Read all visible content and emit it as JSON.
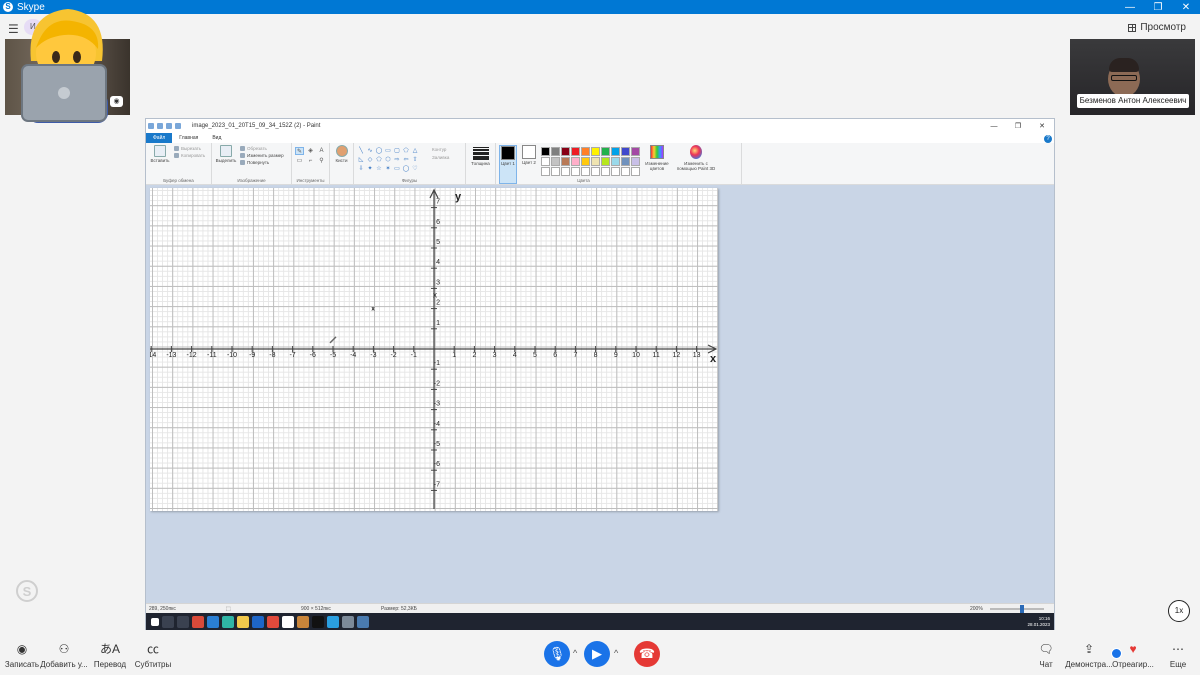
{
  "skype": {
    "window_title": "Skype",
    "menu_icon": "hamburger-menu-icon",
    "user_badge": "И",
    "user_badge_name": "й",
    "view_button": "Просмотр",
    "remote_participant": "Безменов Антон Алексеевич"
  },
  "paint": {
    "title": "image_2023_01_20T15_09_34_152Z (2) - Paint",
    "tabs": [
      "Файл",
      "Главная",
      "Вид"
    ],
    "groups": {
      "clipboard": {
        "label": "Буфер обмена",
        "paste": "Вставить",
        "cut": "Вырезать",
        "copy": "Копировать"
      },
      "image": {
        "label": "Изображение",
        "select": "Выделить",
        "crop": "Обрезать",
        "resize": "Изменить размер",
        "rotate": "Повернуть"
      },
      "tools": {
        "label": "Инструменты"
      },
      "brushes": {
        "label": "Кисти"
      },
      "shapes": {
        "label": "Фигуры",
        "outline": "Контур",
        "fill": "Заливка"
      },
      "thickness": {
        "label": "Толщина"
      },
      "colors": {
        "label": "Цвета",
        "color1": "Цвет 1",
        "color2": "Цвет 2",
        "edit": "Изменение цветов",
        "paint3d": "Изменить с помощью Paint 3D"
      }
    },
    "palette": [
      "#000000",
      "#7f7f7f",
      "#880015",
      "#ed1c24",
      "#ff7f27",
      "#fff200",
      "#22b14c",
      "#00a2e8",
      "#3f48cc",
      "#a349a4",
      "#ffffff",
      "#c3c3c3",
      "#b97a57",
      "#ffaec9",
      "#ffc90e",
      "#efe4b0",
      "#b5e61d",
      "#99d9ea",
      "#7092be",
      "#c8bfe7",
      "#ffffff",
      "#ffffff",
      "#ffffff",
      "#ffffff",
      "#ffffff",
      "#ffffff",
      "#ffffff",
      "#ffffff",
      "#ffffff",
      "#ffffff"
    ],
    "status": {
      "cursor": "289, 250пкс",
      "size": "900 × 512пкс",
      "file_size": "Размер: 52,3КБ",
      "zoom": "200%"
    },
    "taskbar_clock": {
      "time": "10:16",
      "date": "28.01.2023"
    }
  },
  "chart_data": {
    "type": "scatter",
    "xlabel": "x",
    "ylabel": "y",
    "xlim": [
      -14,
      13
    ],
    "ylim": [
      -7,
      7
    ],
    "x_ticks": [
      "-14",
      "-13",
      "-12",
      "-11",
      "-10",
      "-9",
      "-8",
      "-7",
      "-6",
      "-5",
      "-4",
      "-3",
      "-2",
      "-1",
      "1",
      "2",
      "3",
      "4",
      "5",
      "6",
      "7",
      "8",
      "9",
      "10",
      "11",
      "12",
      "13"
    ],
    "y_ticks": [
      "7",
      "6",
      "5",
      "4",
      "3",
      "2",
      "1",
      "-1",
      "-2",
      "-3",
      "-4",
      "-5",
      "-6",
      "-7"
    ],
    "axis_x_marker": "x",
    "annotation": "x",
    "points": [
      {
        "x": -3,
        "y": 2
      }
    ]
  },
  "callbar": {
    "record": "Записать",
    "add_user": "Добавить у...",
    "translate": "Перевод",
    "subtitles": "Субтитры",
    "chat": "Чат",
    "share": "Демонстра...",
    "react": "Отреагир...",
    "more": "Еще",
    "speed": "1x"
  }
}
